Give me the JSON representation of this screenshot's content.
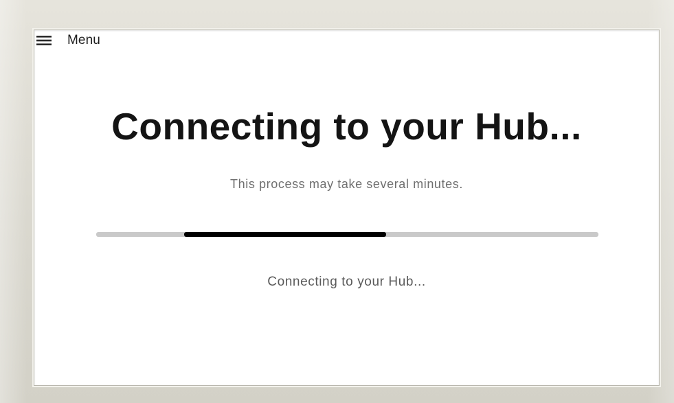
{
  "menu": {
    "icon": "hamburger-menu-icon",
    "label": "Menu"
  },
  "main": {
    "title": "Connecting to your Hub...",
    "subtitle": "This process may take several minutes.",
    "status": "Connecting to your Hub..."
  },
  "progress": {
    "indeterminate": true,
    "segment_start_fraction": 0.175,
    "segment_end_fraction": 0.577,
    "track_color": "#c9c9c9",
    "fill_color": "#000000"
  }
}
